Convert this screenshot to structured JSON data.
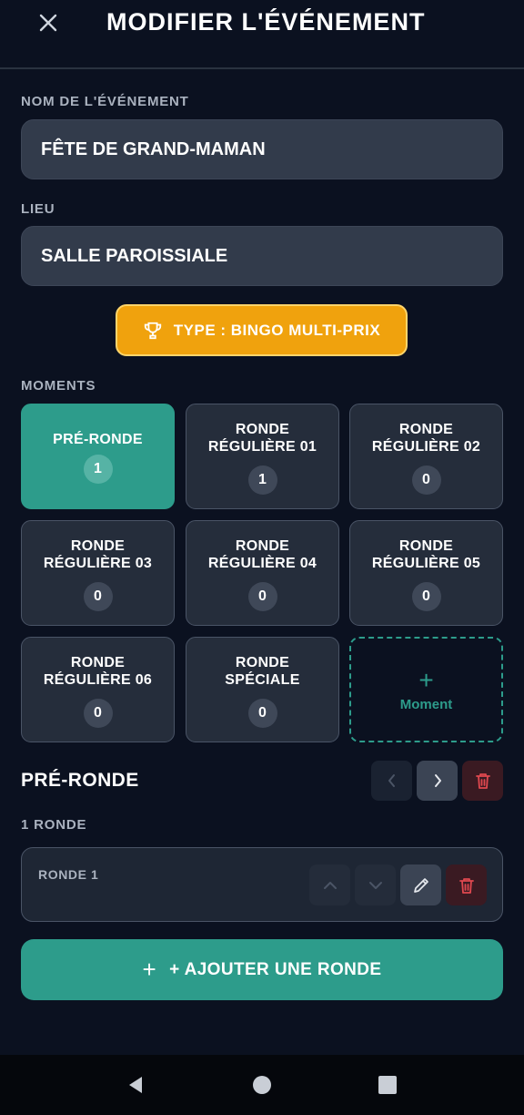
{
  "header": {
    "title": "MODIFIER L'ÉVÉNEMENT",
    "close_icon": "close-icon"
  },
  "form": {
    "event_name_label": "NOM DE L'ÉVÉNEMENT",
    "event_name_value": "FÊTE DE GRAND-MAMAN",
    "location_label": "LIEU",
    "location_value": "SALLE PAROISSIALE"
  },
  "type_badge": {
    "icon": "trophy-icon",
    "label": "TYPE : BINGO MULTI-PRIX"
  },
  "moments": {
    "label": "MOMENTS",
    "items": [
      {
        "label": "PRÉ-RONDE",
        "count": "1",
        "active": true
      },
      {
        "label": "RONDE\nRÉGULIÈRE 01",
        "count": "1",
        "active": false
      },
      {
        "label": "RONDE\nRÉGULIÈRE 02",
        "count": "0",
        "active": false
      },
      {
        "label": "RONDE\nRÉGULIÈRE 03",
        "count": "0",
        "active": false
      },
      {
        "label": "RONDE\nRÉGULIÈRE 04",
        "count": "0",
        "active": false
      },
      {
        "label": "RONDE\nRÉGULIÈRE 05",
        "count": "0",
        "active": false
      },
      {
        "label": "RONDE\nRÉGULIÈRE 06",
        "count": "0",
        "active": false
      },
      {
        "label": "RONDE\nSPÉCIALE",
        "count": "0",
        "active": false
      }
    ],
    "add_plus": "+",
    "add_label": "Moment"
  },
  "selected_moment": {
    "title": "PRÉ-RONDE",
    "rounds_count_label": "1 RONDE",
    "rounds": [
      {
        "label": "RONDE 1"
      }
    ]
  },
  "add_round_button": {
    "icon": "+",
    "label": "+ AJOUTER UNE RONDE"
  },
  "colors": {
    "background": "#0b1120",
    "accent_teal": "#2d9c8b",
    "badge_orange": "#f0a20d",
    "danger_red": "#e0484f",
    "field_bg": "#323b4b"
  }
}
